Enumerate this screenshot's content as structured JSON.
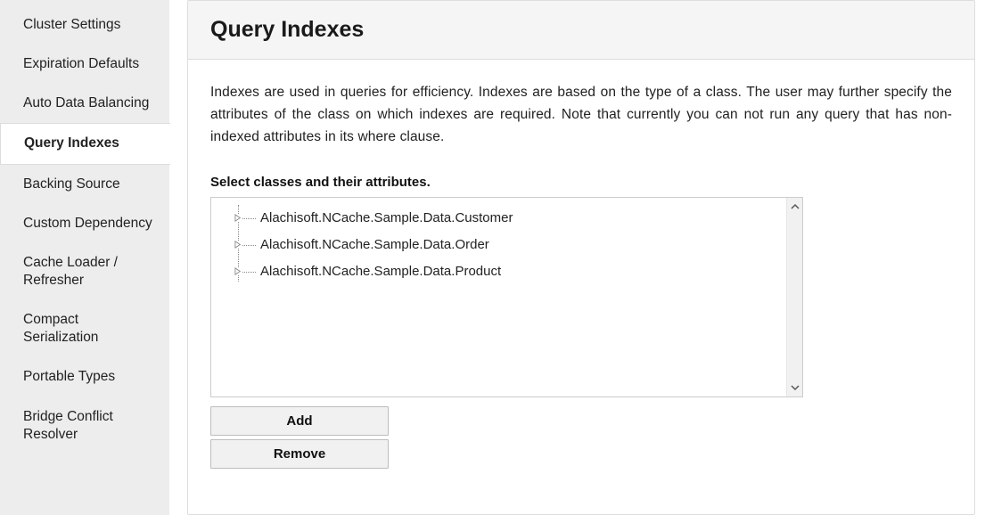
{
  "sidebar": {
    "items": [
      {
        "label": "Cluster Settings"
      },
      {
        "label": "Expiration Defaults"
      },
      {
        "label": "Auto Data Balancing"
      },
      {
        "label": "Query Indexes",
        "active": true
      },
      {
        "label": "Backing Source"
      },
      {
        "label": "Custom Dependency"
      },
      {
        "label": "Cache Loader / Refresher"
      },
      {
        "label": "Compact Serialization"
      },
      {
        "label": "Portable Types"
      },
      {
        "label": "Bridge Conflict Resolver"
      }
    ]
  },
  "main": {
    "title": "Query Indexes",
    "description": "Indexes are used in queries for efficiency. Indexes are based on the type of a class. The user may further specify the attributes of the class on which indexes are required. Note that currently you can not run any query that has non-indexed attributes in its where clause.",
    "select_label": "Select classes and their attributes",
    "classes": [
      "Alachisoft.NCache.Sample.Data.Customer",
      "Alachisoft.NCache.Sample.Data.Order",
      "Alachisoft.NCache.Sample.Data.Product"
    ],
    "buttons": {
      "add": "Add",
      "remove": "Remove"
    }
  }
}
